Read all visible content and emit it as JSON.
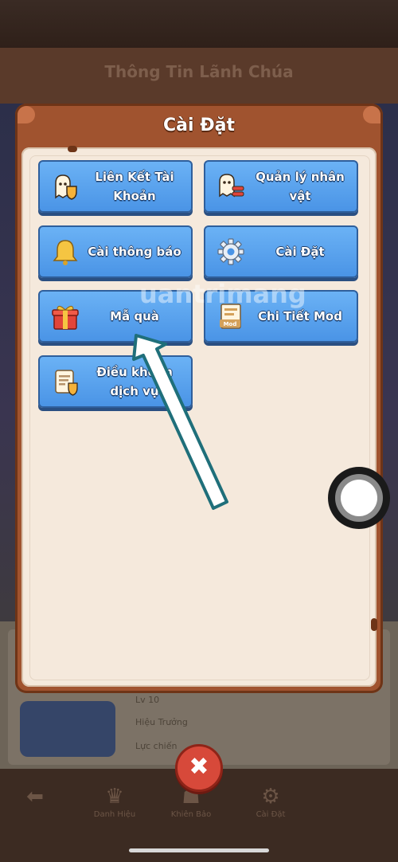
{
  "background": {
    "header_title": "Thông Tin Lãnh Chúa",
    "lower_texts": [
      "Lv 10",
      "Hiệu Trưởng",
      "Lực chiến"
    ],
    "nav": [
      {
        "icon": "back-arrow-icon",
        "glyph": "⬅",
        "label": ""
      },
      {
        "icon": "crown-icon",
        "glyph": "♛",
        "label": "Danh Hiệu"
      },
      {
        "icon": "helmet-icon",
        "glyph": "☗",
        "label": "Khiên Bảo"
      },
      {
        "icon": "settings-icon",
        "glyph": "⚙",
        "label": "Cài Đặt"
      }
    ]
  },
  "dialog": {
    "title": "Cài Đặt",
    "buttons": [
      {
        "label": "Liên Kết Tài Khoản",
        "icon": "ghost-shield-icon"
      },
      {
        "label": "Quản lý nhân vật",
        "icon": "ghost-swap-icon"
      },
      {
        "label": "Cài thông báo",
        "icon": "bell-icon"
      },
      {
        "label": "Cài Đặt",
        "icon": "gear-icon"
      },
      {
        "label": "Mẫ quà",
        "icon": "gift-icon"
      },
      {
        "label": "Chi Tiết Mod",
        "icon": "mod-document-icon"
      },
      {
        "label": "Điều khoản dịch vụ",
        "icon": "terms-document-icon"
      }
    ],
    "mod_icon_text": "Mod"
  },
  "close_button": {
    "glyph": "✖"
  },
  "watermark": "uantrimang",
  "colors": {
    "button_blue": "#4a94e6",
    "dialog_brown": "#a0532f",
    "panel_cream": "#f5e9dc",
    "close_red": "#d7493a",
    "arrow_teal": "#1f6f7a"
  }
}
